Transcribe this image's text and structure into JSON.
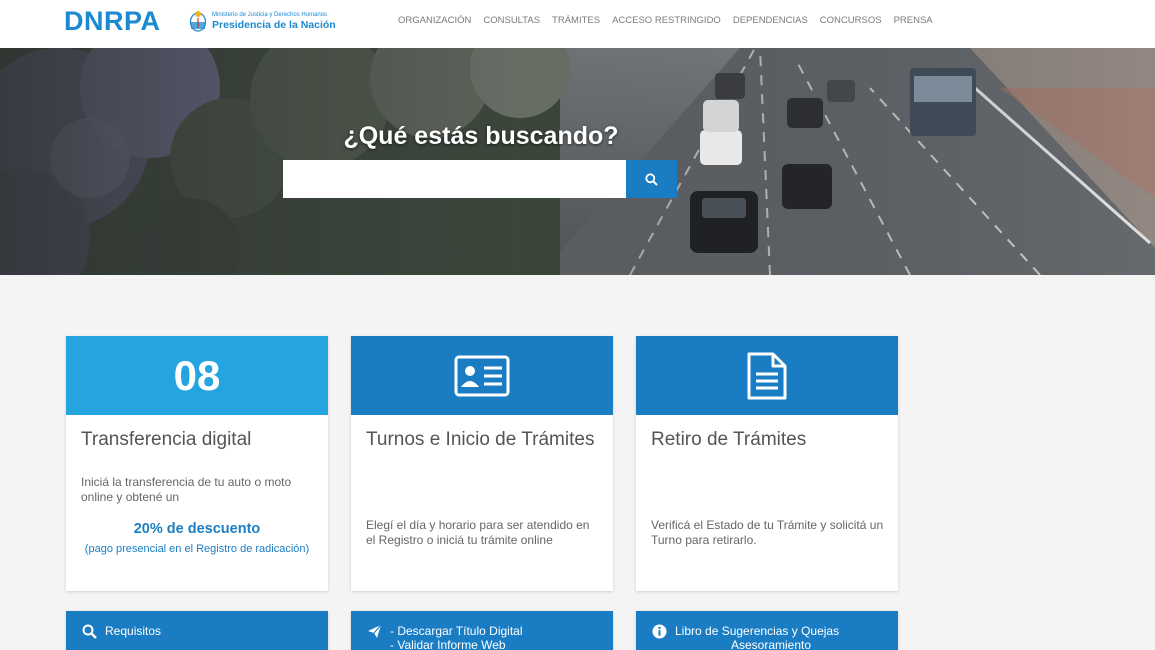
{
  "header": {
    "logo": "DNRPA",
    "gov_small": "Ministerio de Justicia y Derechos Humanos",
    "gov_big": "Presidencia de la Nación",
    "nav": [
      "ORGANIZACIÓN",
      "CONSULTAS",
      "TRÁMITES",
      "ACCESO RESTRINGIDO",
      "DEPENDENCIAS",
      "CONCURSOS",
      "PRENSA"
    ]
  },
  "hero": {
    "title": "¿Qué estás buscando?",
    "search_value": "",
    "search_placeholder": ""
  },
  "cards": [
    {
      "number": "08",
      "title": "Transferencia digital",
      "text": "Iniciá la transferencia de tu auto o moto online y obtené un",
      "discount": "20% de descuento",
      "discount_note": "(pago presencial en el Registro de radicación)"
    },
    {
      "icon": "id-card-icon",
      "title": "Turnos e Inicio de Trámites",
      "text": "Elegí el día y horario para ser atendido en el Registro o iniciá tu trámite online"
    },
    {
      "icon": "document-icon",
      "title": "Retiro de Trámites",
      "text": "Verificá el Estado de tu Trámite y solicitá un Turno para retirarlo."
    }
  ],
  "buttons": [
    {
      "icon": "search-icon",
      "lines": [
        "Requisitos"
      ]
    },
    {
      "icon": "paper-plane-icon",
      "lines": [
        "- Descargar Título Digital",
        "- Validar Informe Web"
      ]
    },
    {
      "icon": "info-icon",
      "lines": [
        "Libro de Sugerencias y Quejas",
        "Asesoramiento"
      ]
    }
  ],
  "colors": {
    "brand": "#1c8ad0",
    "primary_blue": "#1a7dc4",
    "light_blue": "#24a5e0",
    "page_bg": "#f4f4f4"
  }
}
